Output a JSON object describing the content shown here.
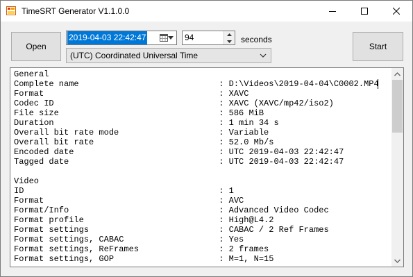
{
  "window": {
    "title": "TimeSRT Generator V1.1.0.0",
    "icon": "app-icon"
  },
  "controls": {
    "open_label": "Open",
    "start_label": "Start",
    "datetime_value": "2019-04-03 22:42:47",
    "seconds_value": "94",
    "seconds_label": "seconds",
    "timezone_value": "(UTC) Coordinated Universal Time"
  },
  "colors": {
    "selection": "#0078d7",
    "window_bg": "#f0f0f0",
    "button_bg": "#e1e1e1"
  },
  "info_lines": [
    "General",
    "Complete name                            : D:\\Videos\\2019-04-04\\C0002.MP4",
    "Format                                   : XAVC",
    "Codec ID                                 : XAVC (XAVC/mp42/iso2)",
    "File size                                : 586 MiB",
    "Duration                                 : 1 min 34 s",
    "Overall bit rate mode                    : Variable",
    "Overall bit rate                         : 52.0 Mb/s",
    "Encoded date                             : UTC 2019-04-03 22:42:47",
    "Tagged date                              : UTC 2019-04-03 22:42:47",
    "",
    "Video",
    "ID                                       : 1",
    "Format                                   : AVC",
    "Format/Info                              : Advanced Video Codec",
    "Format profile                           : High@L4.2",
    "Format settings                          : CABAC / 2 Ref Frames",
    "Format settings, CABAC                   : Yes",
    "Format settings, ReFrames                : 2 frames",
    "Format settings, GOP                     : M=1, N=15"
  ]
}
